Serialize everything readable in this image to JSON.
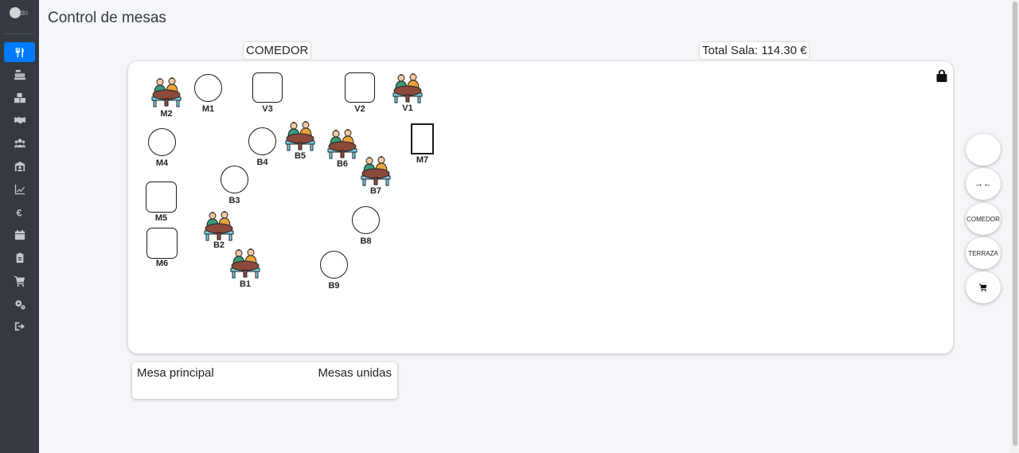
{
  "logo_text": "dn",
  "page_title": "Control de mesas",
  "sidebar": {
    "items": [
      {
        "name": "utensils-icon",
        "active": true
      },
      {
        "name": "cash-register-icon"
      },
      {
        "name": "boxes-icon"
      },
      {
        "name": "handshake-icon"
      },
      {
        "name": "users-icon"
      },
      {
        "name": "warehouse-user-icon"
      },
      {
        "name": "chart-line-icon"
      },
      {
        "name": "euro-icon"
      },
      {
        "name": "calendar-icon"
      },
      {
        "name": "clipboard-icon"
      },
      {
        "name": "shopping-cart-icon"
      },
      {
        "name": "cogs-icon"
      },
      {
        "name": "sign-out-icon"
      }
    ]
  },
  "room": {
    "zone_name": "COMEDOR",
    "total_label": "Total Sala: 114.30 €"
  },
  "tables": [
    {
      "id": "M2",
      "shape": "occupied"
    },
    {
      "id": "M1",
      "shape": "circle"
    },
    {
      "id": "V3",
      "shape": "square"
    },
    {
      "id": "V2",
      "shape": "square"
    },
    {
      "id": "V1",
      "shape": "occupied"
    },
    {
      "id": "M4",
      "shape": "circle"
    },
    {
      "id": "B4",
      "shape": "circle"
    },
    {
      "id": "B5",
      "shape": "occupied"
    },
    {
      "id": "B6",
      "shape": "occupied"
    },
    {
      "id": "M7",
      "shape": "rect"
    },
    {
      "id": "B7",
      "shape": "occupied"
    },
    {
      "id": "B3",
      "shape": "circle"
    },
    {
      "id": "M5",
      "shape": "square"
    },
    {
      "id": "B2",
      "shape": "occupied"
    },
    {
      "id": "B8",
      "shape": "circle"
    },
    {
      "id": "M6",
      "shape": "square"
    },
    {
      "id": "B1",
      "shape": "occupied"
    },
    {
      "id": "B9",
      "shape": "circle"
    }
  ],
  "right_buttons": {
    "blank": "",
    "join_icon": "→←",
    "comedor": "COMEDOR",
    "terraza": "TERRAZA"
  },
  "bottom_panel": {
    "main_table_label": "Mesa principal",
    "joined_tables_label": "Mesas unidas"
  },
  "colors": {
    "sidebar_bg": "#343a40",
    "accent": "#007bff",
    "table_wood": "#8b4a3c",
    "chair_blue": "#7dd3e8",
    "person_green": "#3a9b7a",
    "person_orange": "#e8a33a"
  }
}
